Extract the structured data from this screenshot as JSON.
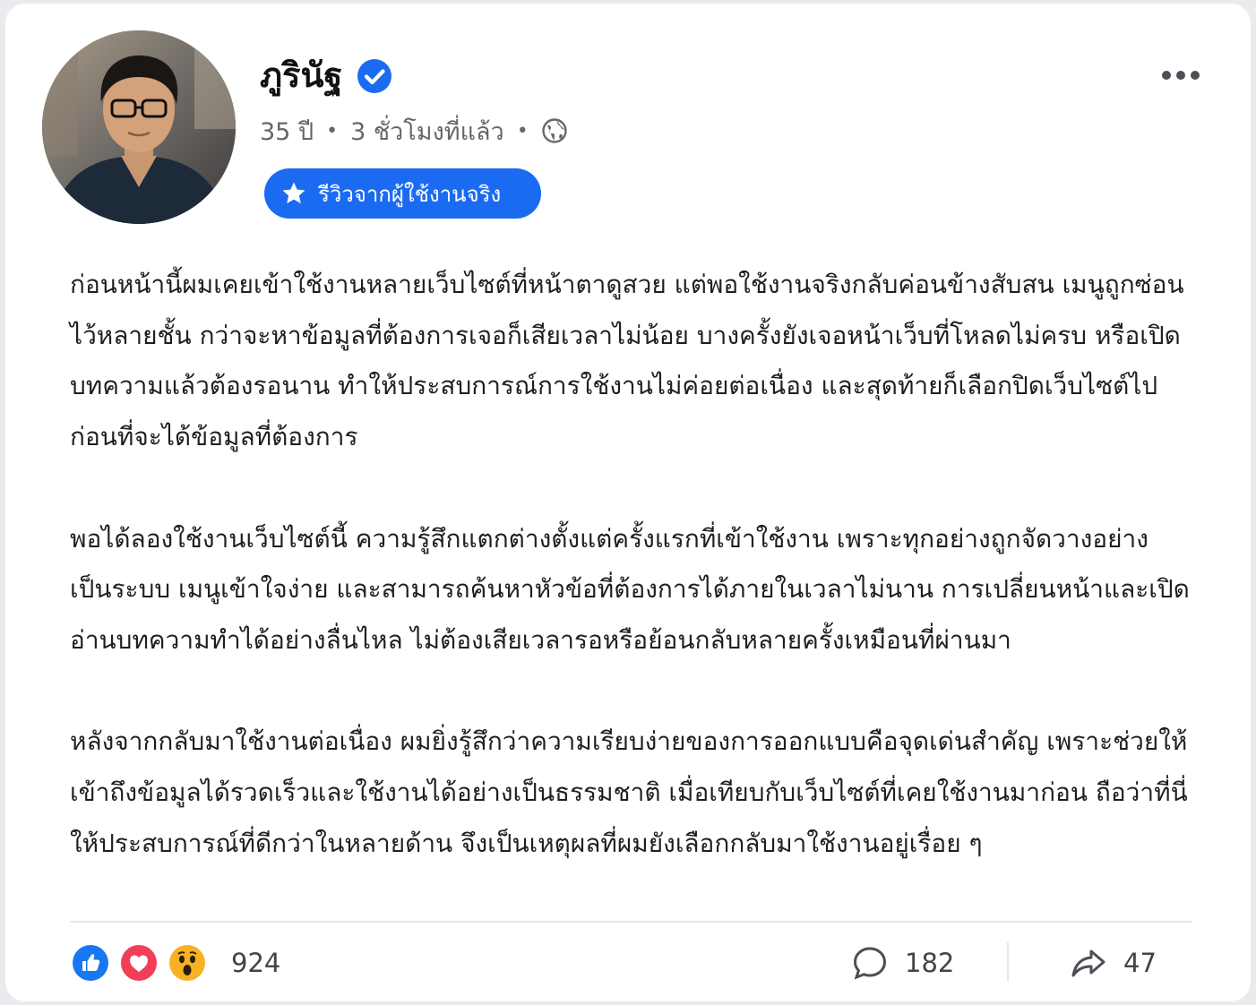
{
  "post": {
    "author": {
      "name": "ภูรินัฐ",
      "verified": true,
      "avatar": "avatar-photo-man-with-glasses"
    },
    "meta": {
      "age": "35 ปี",
      "time": "3 ชั่วโมงที่แล้ว",
      "separator": "•",
      "audience_icon": "globe-icon"
    },
    "badge": {
      "icon": "star-icon",
      "label": "รีวิวจากผู้ใช้งานจริง"
    },
    "more_icon": "more-horizontal-icon",
    "paragraphs": [
      "ก่อนหน้านี้ผมเคยเข้าใช้งานหลายเว็บไซต์ที่หน้าตาดูสวย แต่พอใช้งานจริงกลับค่อนข้างสับสน เมนูถูกซ่อนไว้หลายชั้น กว่าจะหาข้อมูลที่ต้องการเจอก็เสียเวลาไม่น้อย บางครั้งยังเจอหน้าเว็บที่โหลดไม่ครบ หรือเปิดบทความแล้วต้องรอนาน ทำให้ประสบการณ์การใช้งานไม่ค่อยต่อเนื่อง และสุดท้ายก็เลือกปิดเว็บไซต์ไปก่อนที่จะได้ข้อมูลที่ต้องการ",
      "พอได้ลองใช้งานเว็บไซต์นี้ ความรู้สึกแตกต่างตั้งแต่ครั้งแรกที่เข้าใช้งาน เพราะทุกอย่างถูกจัดวางอย่างเป็นระบบ เมนูเข้าใจง่าย และสามารถค้นหาหัวข้อที่ต้องการได้ภายในเวลาไม่นาน การเปลี่ยนหน้าและเปิดอ่านบทความทำได้อย่างลื่นไหล ไม่ต้องเสียเวลารอหรือย้อนกลับหลายครั้งเหมือนที่ผ่านมา",
      "หลังจากกลับมาใช้งานต่อเนื่อง ผมยิ่งรู้สึกว่าความเรียบง่ายของการออกแบบคือจุดเด่นสำคัญ เพราะช่วยให้เข้าถึงข้อมูลได้รวดเร็วและใช้งานได้อย่างเป็นธรรมชาติ เมื่อเทียบกับเว็บไซต์ที่เคยใช้งานมาก่อน ถือว่าที่นี่ให้ประสบการณ์ที่ดีกว่าในหลายด้าน จึงเป็นเหตุผลที่ผมยังเลือกกลับมาใช้งานอยู่เรื่อย ๆ"
    ]
  },
  "footer": {
    "reactions": [
      "like-icon",
      "love-icon",
      "wow-icon"
    ],
    "reaction_count": "924",
    "comment_count": "182",
    "share_count": "47"
  },
  "colors": {
    "accent": "#1b6bf2",
    "like": "#1877f2",
    "love": "#f33e58",
    "wow": "#f7b125",
    "muted": "#65676b"
  }
}
